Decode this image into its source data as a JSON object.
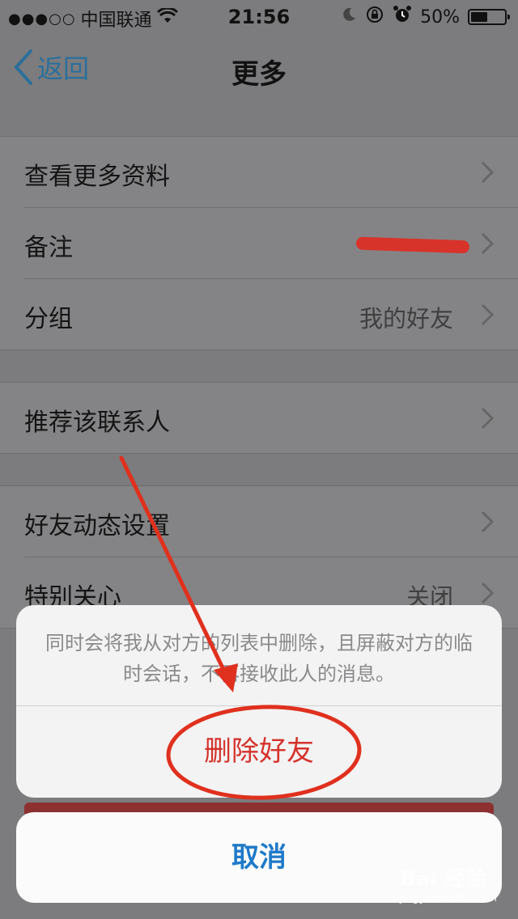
{
  "status_bar": {
    "signal_dots": "●●●○○",
    "carrier": "中国联通",
    "time": "21:56",
    "battery_percent": "50%",
    "battery_level": 0.5,
    "icons": [
      "wifi-icon",
      "moon-icon",
      "rotation-lock-icon",
      "alarm-icon",
      "battery-icon"
    ]
  },
  "nav": {
    "back_label": "返回",
    "title": "更多"
  },
  "groups": [
    {
      "rows": [
        {
          "label": "查看更多资料",
          "value": ""
        },
        {
          "label": "备注",
          "value": ""
        },
        {
          "label": "分组",
          "value": "我的好友"
        }
      ]
    },
    {
      "rows": [
        {
          "label": "推荐该联系人",
          "value": ""
        }
      ]
    },
    {
      "rows": [
        {
          "label": "好友动态设置",
          "value": ""
        },
        {
          "label": "特别关心",
          "value": "关闭"
        }
      ]
    }
  ],
  "action_sheet": {
    "message": "同时会将我从对方的列表中删除，且屏蔽对方的临时会话，不再接收此人的消息。",
    "delete_label": "删除好友",
    "cancel_label": "取消"
  },
  "watermark": {
    "brand": "Bai 经验",
    "url": "jingyan.baidu.com"
  },
  "colors": {
    "accent_blue": "#1f7ac9",
    "destructive_red": "#d5322b",
    "annotation_red": "#e0301e"
  }
}
